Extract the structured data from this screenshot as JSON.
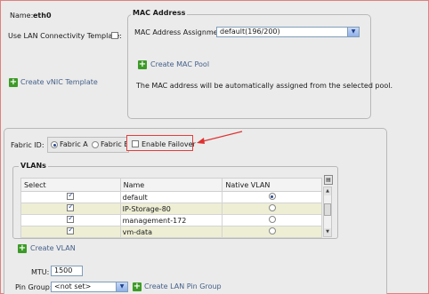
{
  "name_label": "Name:",
  "name_value": "eth0",
  "lan_template_label": "Use LAN Connectivity Template:",
  "create_vnic_template": "Create vNIC Template",
  "mac": {
    "legend": "MAC Address",
    "assignment_label": "MAC Address Assignment:",
    "assignment_value": "default(196/200)",
    "create_pool": "Create MAC Pool",
    "note": "The MAC address will be automatically assigned from the selected pool."
  },
  "fabric": {
    "label": "Fabric ID:",
    "option_a": "Fabric A",
    "option_b": "Fabric B",
    "selected": "Fabric A",
    "failover_label": "Enable Failover"
  },
  "vlans": {
    "legend": "VLANs",
    "columns": [
      "Select",
      "Name",
      "Native VLAN"
    ],
    "rows": [
      {
        "name": "default",
        "selected": true,
        "native": true
      },
      {
        "name": "IP-Storage-80",
        "selected": true,
        "native": false
      },
      {
        "name": "management-172",
        "selected": true,
        "native": false
      },
      {
        "name": "vm-data",
        "selected": true,
        "native": false
      }
    ]
  },
  "create_vlan": "Create VLAN",
  "mtu": {
    "label": "MTU:",
    "value": "1500"
  },
  "pin_group": {
    "label": "Pin Group:",
    "value": "<not set>",
    "create": "Create LAN Pin Group"
  },
  "colors": {
    "annotation_arrow": "#e03030",
    "add_icon": "#3c9b26",
    "link": "#44608a"
  }
}
